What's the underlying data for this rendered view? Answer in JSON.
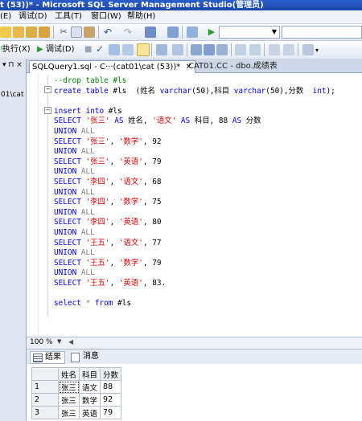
{
  "window": {
    "title": "t (53))* - Microsoft SQL Server Management Studio(管理员)"
  },
  "menu": [
    "(E)",
    "调试(D)",
    "工具(T)",
    "窗口(W)",
    "帮助(H)"
  ],
  "toolbar2": {
    "execute_label": "执行(X)",
    "debug_label": "调试(D)"
  },
  "left_panel": {
    "label": "01\\cat"
  },
  "tabs": [
    {
      "label": "SQLQuery1.sql - C···(cat01\\cat (53))*"
    },
    {
      "label": "CAT01.CC - dbo.成绩表"
    }
  ],
  "code": [
    [
      {
        "t": "--drop table #ls",
        "c": "cm"
      }
    ],
    [
      {
        "t": "create table",
        "c": "kw"
      },
      {
        "t": " #ls  (姓名 ",
        "c": ""
      },
      {
        "t": "varchar",
        "c": "kw"
      },
      {
        "t": "(50),科目 ",
        "c": ""
      },
      {
        "t": "varchar",
        "c": "kw"
      },
      {
        "t": "(50),分数  ",
        "c": ""
      },
      {
        "t": "int",
        "c": "kw"
      },
      {
        "t": ");",
        "c": ""
      }
    ],
    [
      {
        "t": "",
        "c": ""
      }
    ],
    [
      {
        "t": "insert into",
        "c": "kw"
      },
      {
        "t": " #ls",
        "c": ""
      }
    ],
    [
      {
        "t": "SELECT ",
        "c": "kw"
      },
      {
        "t": "'张三'",
        "c": "str"
      },
      {
        "t": " AS ",
        "c": "kw"
      },
      {
        "t": "姓名, ",
        "c": ""
      },
      {
        "t": "'语文'",
        "c": "str"
      },
      {
        "t": " AS ",
        "c": "kw"
      },
      {
        "t": "科目, 88 ",
        "c": ""
      },
      {
        "t": "AS",
        "c": "kw"
      },
      {
        "t": " 分数",
        "c": ""
      }
    ],
    [
      {
        "t": "UNION ",
        "c": "kw"
      },
      {
        "t": "ALL",
        "c": "gr"
      }
    ],
    [
      {
        "t": "SELECT ",
        "c": "kw"
      },
      {
        "t": "'张三'",
        "c": "str"
      },
      {
        "t": ", ",
        "c": ""
      },
      {
        "t": "'数学'",
        "c": "str"
      },
      {
        "t": ", 92",
        "c": ""
      }
    ],
    [
      {
        "t": "UNION ",
        "c": "kw"
      },
      {
        "t": "ALL",
        "c": "gr"
      }
    ],
    [
      {
        "t": "SELECT ",
        "c": "kw"
      },
      {
        "t": "'张三'",
        "c": "str"
      },
      {
        "t": ", ",
        "c": ""
      },
      {
        "t": "'英语'",
        "c": "str"
      },
      {
        "t": ", 79",
        "c": ""
      }
    ],
    [
      {
        "t": "UNION ",
        "c": "kw"
      },
      {
        "t": "ALL",
        "c": "gr"
      }
    ],
    [
      {
        "t": "SELECT ",
        "c": "kw"
      },
      {
        "t": "'李四'",
        "c": "str"
      },
      {
        "t": ", ",
        "c": ""
      },
      {
        "t": "'语文'",
        "c": "str"
      },
      {
        "t": ", 68",
        "c": ""
      }
    ],
    [
      {
        "t": "UNION ",
        "c": "kw"
      },
      {
        "t": "ALL",
        "c": "gr"
      }
    ],
    [
      {
        "t": "SELECT ",
        "c": "kw"
      },
      {
        "t": "'李四'",
        "c": "str"
      },
      {
        "t": ", ",
        "c": ""
      },
      {
        "t": "'数学'",
        "c": "str"
      },
      {
        "t": ", 75",
        "c": ""
      }
    ],
    [
      {
        "t": "UNION ",
        "c": "kw"
      },
      {
        "t": "ALL",
        "c": "gr"
      }
    ],
    [
      {
        "t": "SELECT ",
        "c": "kw"
      },
      {
        "t": "'李四'",
        "c": "str"
      },
      {
        "t": ", ",
        "c": ""
      },
      {
        "t": "'英语'",
        "c": "str"
      },
      {
        "t": ", 80",
        "c": ""
      }
    ],
    [
      {
        "t": "UNION ",
        "c": "kw"
      },
      {
        "t": "ALL",
        "c": "gr"
      }
    ],
    [
      {
        "t": "SELECT ",
        "c": "kw"
      },
      {
        "t": "'王五'",
        "c": "str"
      },
      {
        "t": ", ",
        "c": ""
      },
      {
        "t": "'语文'",
        "c": "str"
      },
      {
        "t": ", 77",
        "c": ""
      }
    ],
    [
      {
        "t": "UNION ",
        "c": "kw"
      },
      {
        "t": "ALL",
        "c": "gr"
      }
    ],
    [
      {
        "t": "SELECT ",
        "c": "kw"
      },
      {
        "t": "'王五'",
        "c": "str"
      },
      {
        "t": ", ",
        "c": ""
      },
      {
        "t": "'数学'",
        "c": "str"
      },
      {
        "t": ", 79",
        "c": ""
      }
    ],
    [
      {
        "t": "UNION ",
        "c": "kw"
      },
      {
        "t": "ALL",
        "c": "gr"
      }
    ],
    [
      {
        "t": "SELECT ",
        "c": "kw"
      },
      {
        "t": "'王五'",
        "c": "str"
      },
      {
        "t": ", ",
        "c": ""
      },
      {
        "t": "'英语'",
        "c": "str"
      },
      {
        "t": ", 83.",
        "c": ""
      }
    ],
    [
      {
        "t": "",
        "c": ""
      }
    ],
    [
      {
        "t": "select ",
        "c": "kw"
      },
      {
        "t": "* ",
        "c": "gr"
      },
      {
        "t": "from",
        "c": "kw"
      },
      {
        "t": " #ls",
        "c": ""
      }
    ]
  ],
  "zoom": "100 %",
  "result_tabs": {
    "results": "结果",
    "messages": "消息"
  },
  "results": {
    "columns": [
      "姓名",
      "科目",
      "分数"
    ],
    "rows": [
      [
        "1",
        "张三",
        "语文",
        "88"
      ],
      [
        "2",
        "张三",
        "数学",
        "92"
      ],
      [
        "3",
        "张三",
        "英语",
        "79"
      ]
    ]
  }
}
